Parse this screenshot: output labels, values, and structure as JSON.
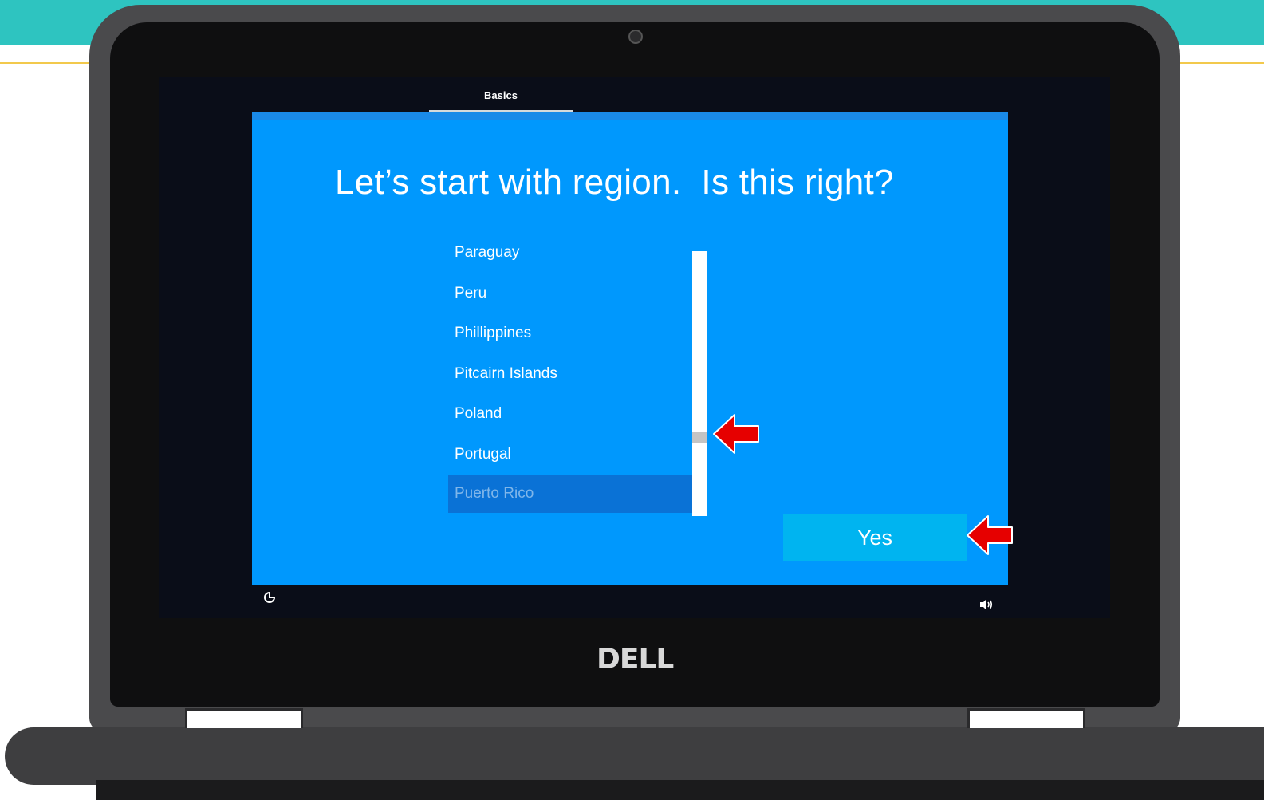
{
  "device": {
    "brand_logo": "DELL"
  },
  "setup": {
    "tab_label": "Basics",
    "title": "Let’s start with region.  Is this right?",
    "regions": [
      "Paraguay",
      "Peru",
      "Phillippines",
      "Pitcairn Islands",
      "Poland",
      "Portugal",
      "Puerto Rico"
    ],
    "selected_region": "Puerto Rico",
    "yes_label": "Yes"
  },
  "taskbar": {
    "left_icon": "ease-of-access-icon",
    "right_icon": "volume-icon"
  },
  "annotations": {
    "arrow_color": "#e60000"
  },
  "colors": {
    "oobe_background": "#0098fd",
    "selected_row": "#0a72d6",
    "yes_button": "#00b4f0",
    "frame_teal": "#2ec4c0"
  }
}
